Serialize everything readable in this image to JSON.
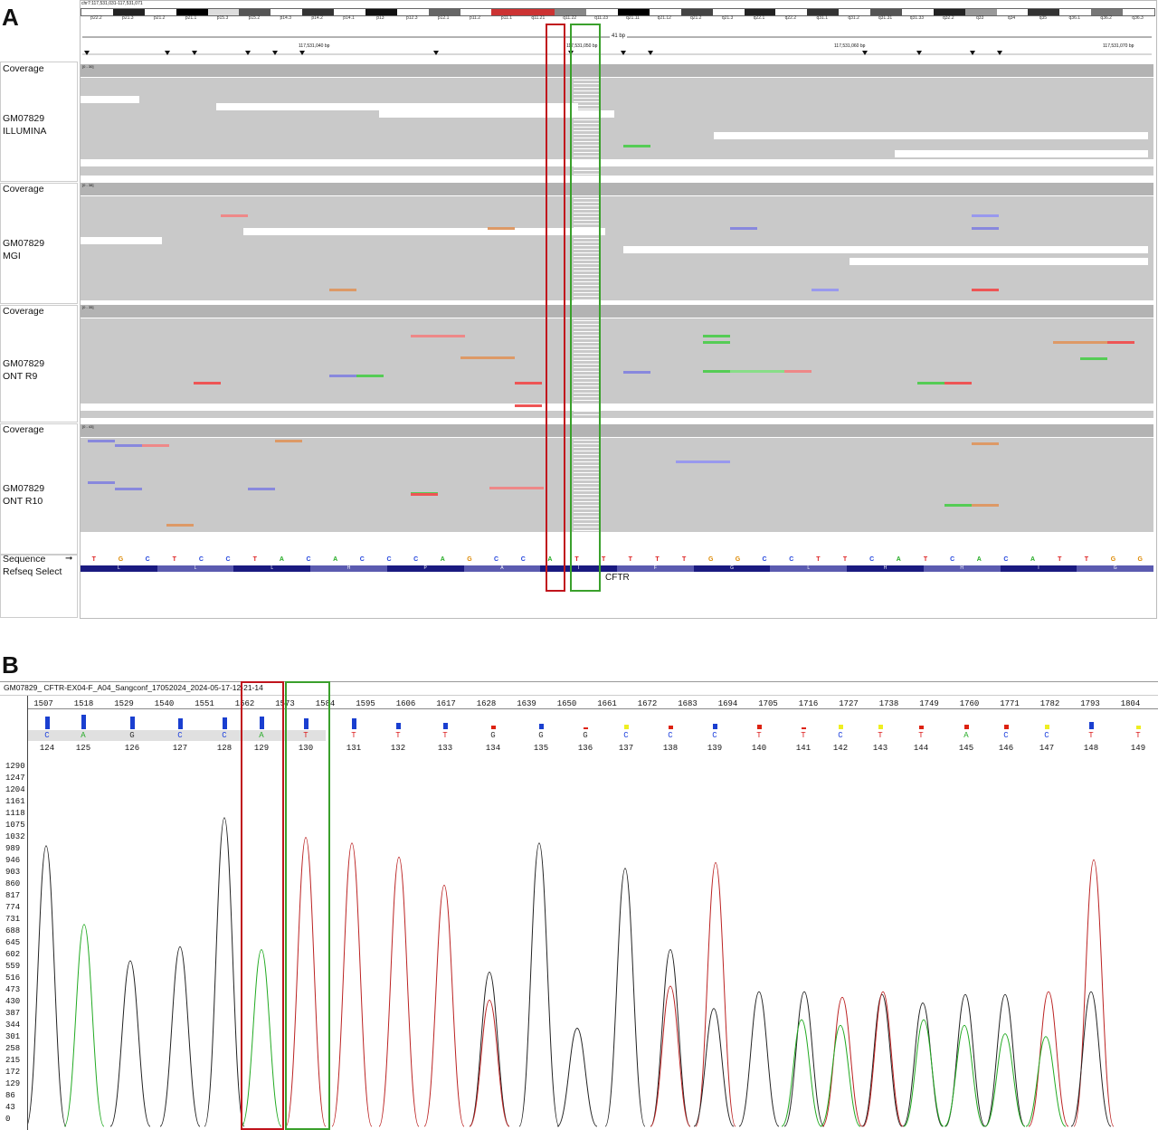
{
  "panel_a_label": "A",
  "panel_b_label": "B",
  "igv": {
    "locus": "chr7:117,531,031-117,531,071",
    "span": "41 bp",
    "ruler_labels": [
      "117,531,040 bp",
      "117,531,050 bp",
      "117,531,060 bp",
      "117,531,070 bp"
    ],
    "bands": [
      "p22.2",
      "p21.3",
      "p21.2",
      "p21.1",
      "p15.3",
      "p15.2",
      "p14.3",
      "p14.2",
      "p14.1",
      "p13",
      "p12.3",
      "p12.1",
      "p11.2",
      "p11.1",
      "q11.21",
      "q11.22",
      "q11.23",
      "q21.11",
      "q21.12",
      "q21.2",
      "q21.3",
      "q22.1",
      "q22.2",
      "q31.1",
      "q31.2",
      "q31.31",
      "q31.33",
      "q32.2",
      "q33",
      "q34",
      "q35",
      "q36.1",
      "q36.2",
      "q36.3"
    ],
    "tracks": [
      {
        "coverage_label": "Coverage",
        "sample": "GM07829",
        "platform": "ILLUMINA",
        "range": "[0 - 30]"
      },
      {
        "coverage_label": "Coverage",
        "sample": "GM07829",
        "platform": "MGI",
        "range": "[0 - 38]"
      },
      {
        "coverage_label": "Coverage",
        "sample": "GM07829",
        "platform": "ONT R9",
        "range": "[0 - 35]"
      },
      {
        "coverage_label": "Coverage",
        "sample": "GM07829",
        "platform": "ONT R10",
        "range": "[0 - 43]"
      }
    ],
    "sequence_label": "Sequence",
    "refseq_label": "Refseq Select",
    "sequence": [
      "T",
      "G",
      "C",
      "T",
      "C",
      "C",
      "T",
      "A",
      "C",
      "A",
      "C",
      "C",
      "C",
      "A",
      "G",
      "C",
      "C",
      "A",
      "T",
      "T",
      "T",
      "T",
      "T",
      "G",
      "G",
      "C",
      "C",
      "T",
      "T",
      "C",
      "A",
      "T",
      "C",
      "A",
      "C",
      "A",
      "T",
      "T",
      "G",
      "G"
    ],
    "amino_acids": [
      "L",
      "L",
      "L",
      "H",
      "P",
      "A",
      "I",
      "F",
      "G",
      "L",
      "H",
      "H",
      "I",
      "G"
    ],
    "gene": "CFTR",
    "colors": {
      "A": "#22aa22",
      "C": "#2244dd",
      "G": "#dd8800",
      "T": "#dd2222"
    }
  },
  "sanger": {
    "title": "GM07829_ CFTR-EX04-F_A04_Sangconf_17052024_2024-05-17-12-21-14",
    "positions": [
      "1507",
      "1518",
      "1529",
      "1540",
      "1551",
      "1562",
      "1573",
      "1584",
      "1595",
      "1606",
      "1617",
      "1628",
      "1639",
      "1650",
      "1661",
      "1672",
      "1683",
      "1694",
      "1705",
      "1716",
      "1727",
      "1738",
      "1749",
      "1760",
      "1771",
      "1782",
      "1793",
      "1804"
    ],
    "calls": [
      "C",
      "A",
      "G",
      "C",
      "C",
      "A",
      "T",
      "T",
      "T",
      "T",
      "G",
      "G",
      "G",
      "C",
      "C",
      "C",
      "T",
      "T",
      "C",
      "T",
      "T",
      "A",
      "C",
      "C",
      "T",
      "T",
      "T"
    ],
    "indices": [
      "124",
      "125",
      "126",
      "127",
      "128",
      "129",
      "130",
      "131",
      "132",
      "133",
      "134",
      "135",
      "136",
      "137",
      "138",
      "139",
      "140",
      "141",
      "142",
      "143",
      "144",
      "145",
      "146",
      "147",
      "148",
      "149"
    ],
    "y_ticks": [
      "1290",
      "1247",
      "1204",
      "1161",
      "1118",
      "1075",
      "1032",
      "989",
      "946",
      "903",
      "860",
      "817",
      "774",
      "731",
      "688",
      "645",
      "602",
      "559",
      "516",
      "473",
      "430",
      "387",
      "344",
      "301",
      "258",
      "215",
      "172",
      "129",
      "86",
      "43",
      "0"
    ]
  }
}
